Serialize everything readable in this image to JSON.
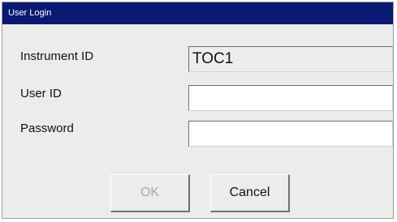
{
  "window": {
    "title": "User Login"
  },
  "form": {
    "instrument_id": {
      "label": "Instrument ID",
      "value": "TOC1"
    },
    "user_id": {
      "label": "User ID",
      "value": "",
      "placeholder": ""
    },
    "password": {
      "label": "Password",
      "value": "",
      "placeholder": ""
    }
  },
  "buttons": {
    "ok_label": "OK",
    "ok_enabled": false,
    "cancel_label": "Cancel"
  },
  "colors": {
    "titlebar": "#0a1a74",
    "dialog_bg": "#ececec",
    "disabled_text": "#a8a8a8"
  }
}
